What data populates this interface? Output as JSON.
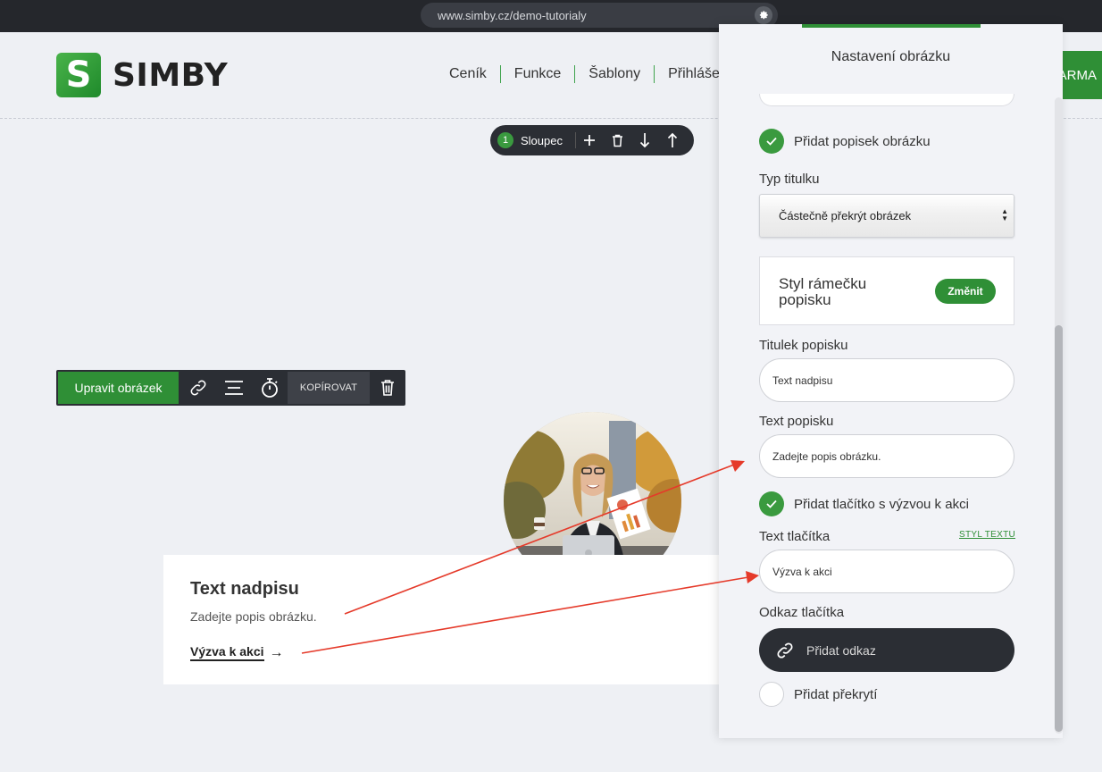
{
  "browser": {
    "url": "www.simby.cz/demo-tutorialy"
  },
  "site": {
    "logo_letter": "S",
    "logo_text": "SIMBY",
    "nav": [
      {
        "label": "Ceník"
      },
      {
        "label": "Funkce"
      },
      {
        "label": "Šablony"
      },
      {
        "label": "Přihláše"
      }
    ],
    "cta_partial": "ARMA"
  },
  "column_toolbar": {
    "badge": "1",
    "label": "Sloupec",
    "icons": [
      "plus-icon",
      "trash-icon",
      "arrow-down-icon",
      "arrow-up-icon"
    ]
  },
  "image_toolbar": {
    "edit_label": "Upravit obrázek",
    "copy_label": "KOPÍROVAT",
    "icons": [
      "link-icon",
      "align-icon",
      "timer-icon",
      "trash-icon"
    ]
  },
  "card": {
    "title": "Text nadpisu",
    "description": "Zadejte popis obrázku.",
    "cta": "Výzva k akci",
    "cta_arrow": "→"
  },
  "panel": {
    "title": "Nastavení obrázku",
    "add_caption": {
      "label": "Přidat popisek obrázku",
      "checked": true
    },
    "title_type": {
      "label": "Typ titulku",
      "value": "Částečně překrýt obrázek"
    },
    "frame_style": {
      "label": "Styl rámečku popisku",
      "button": "Změnit"
    },
    "caption_title": {
      "label": "Titulek popisku",
      "value": "Text nadpisu"
    },
    "caption_text": {
      "label": "Text popisku",
      "value": "Zadejte popis obrázku."
    },
    "add_cta": {
      "label": "Přidat tlačítko s výzvou k akci",
      "checked": true
    },
    "button_text": {
      "label": "Text tlačítka",
      "style_link": "STYL TEXTU",
      "value": "Výzva k akci"
    },
    "button_link": {
      "label": "Odkaz tlačítka",
      "button": "Přidat odkaz"
    },
    "add_overlay": {
      "label": "Přidat překrytí",
      "checked": false
    }
  },
  "colors": {
    "brand_green": "#2f8f36",
    "dark_toolbar": "#2b2e34",
    "annotation_arrow": "#e53a2a"
  }
}
